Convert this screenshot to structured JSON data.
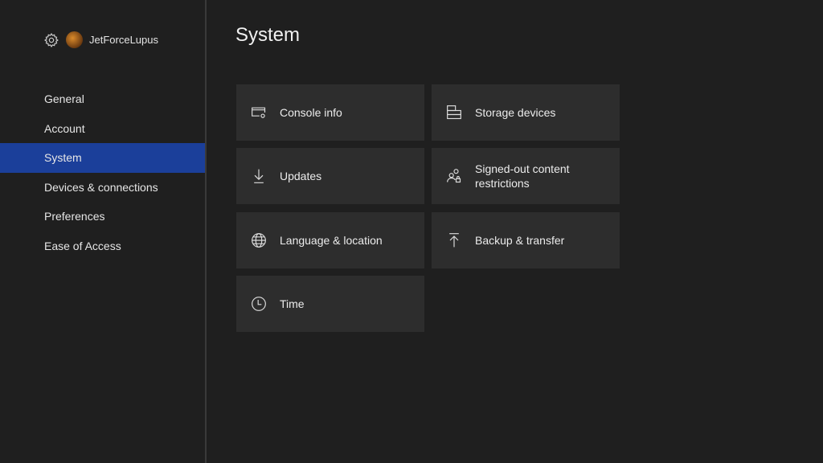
{
  "profile": {
    "username": "JetForceLupus"
  },
  "sidebar": {
    "items": [
      {
        "label": "General"
      },
      {
        "label": "Account"
      },
      {
        "label": "System",
        "active": true
      },
      {
        "label": "Devices & connections"
      },
      {
        "label": "Preferences"
      },
      {
        "label": "Ease of Access"
      }
    ]
  },
  "page": {
    "title": "System"
  },
  "tiles": [
    {
      "label": "Console info",
      "icon": "console-info-icon"
    },
    {
      "label": "Storage devices",
      "icon": "storage-icon"
    },
    {
      "label": "Updates",
      "icon": "download-icon"
    },
    {
      "label": "Signed-out content restrictions",
      "icon": "users-lock-icon"
    },
    {
      "label": "Language & location",
      "icon": "globe-icon"
    },
    {
      "label": "Backup & transfer",
      "icon": "upload-icon"
    },
    {
      "label": "Time",
      "icon": "clock-icon"
    }
  ],
  "colors": {
    "accent": "#1b3f9a",
    "tile": "#2d2d2d",
    "background": "#1f1f1f"
  }
}
